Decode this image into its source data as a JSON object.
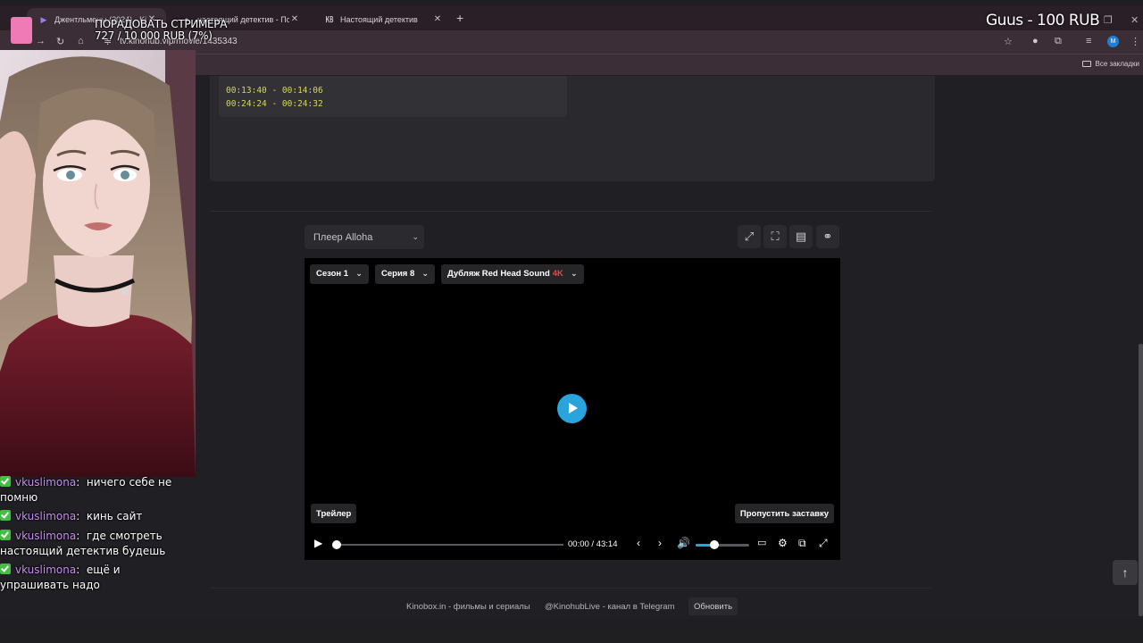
{
  "browser": {
    "tabs": [
      {
        "label": "Джентльмены (2024) - Kinob",
        "active": true
      },
      {
        "label": "настоящий детектив - Поиск в",
        "active": false
      },
      {
        "label": "Настоящий детектив",
        "active": false
      }
    ],
    "url": "tv.kinohub.vip/movie/1435343",
    "bookmarks_label": "Все закладки",
    "profile_initial": "M"
  },
  "page": {
    "timecodes": [
      "00:13:40 - 00:14:06",
      "00:24:24 - 00:24:32"
    ],
    "player_select": "Плеер Alloha",
    "tool_icons": [
      "expand-icon",
      "fullscreen-icon",
      "comment-icon",
      "link-icon"
    ]
  },
  "player": {
    "season": "Сезон 1",
    "episode": "Серия 8",
    "dub": "Дубляж Red Head Sound",
    "dub_quality": "4K",
    "trailer_btn": "Трейлер",
    "skip_intro_btn": "Пропустить заставку",
    "time_current": "00:00",
    "time_separator": "/",
    "time_total": "43:14",
    "progress_fraction": 0,
    "volume_fraction": 0.35,
    "accent_color": "#2aa4dc"
  },
  "footer": {
    "site_link": "Kinobox.in - фильмы и сериалы",
    "telegram_link": "@KinohubLive - канал в Telegram",
    "refresh_btn": "Обновить"
  },
  "stream_overlay": {
    "goal_title": "ПОРАДОВАТЬ СТРИМЕРА",
    "goal_progress": "727 / 10 000 RUB (7%)",
    "donation_alert": "Guus - 100 RUB"
  },
  "chat": [
    {
      "user": "vkuslimona",
      "text": "ничего себе не помню"
    },
    {
      "user": "vkuslimona",
      "text": "кинь сайт"
    },
    {
      "user": "vkuslimona",
      "text": "где смотреть настоящий детектив будешь"
    },
    {
      "user": "vkuslimona",
      "text": "ещё и упрашивать надо"
    }
  ]
}
